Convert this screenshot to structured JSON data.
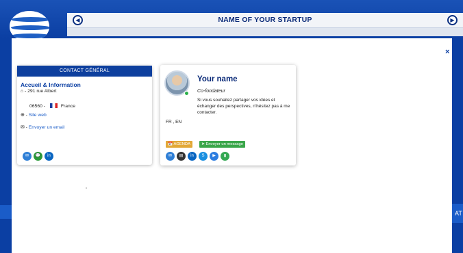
{
  "header": {
    "title": "NAME OF YOUR  STARTUP",
    "prev_arrow": "◀",
    "next_arrow": "▶"
  },
  "side_tab": {
    "label": "AT"
  },
  "modal": {
    "close_label": "×"
  },
  "contact": {
    "header": "CONTACT GÉNÉRAL",
    "section_title": "Accueil & Information",
    "address_icon": "⌂",
    "address": "- 291 rue Albert",
    "postal": "06560 -",
    "country": "France",
    "web_icon": "⊕",
    "web_prefix": "-",
    "website_label": "Site web",
    "email_icon": "✉",
    "email_prefix": "-",
    "email_label": "Envoyer un email",
    "socials": [
      {
        "name": "email",
        "glyph": "✉",
        "color": "#2f7fd6"
      },
      {
        "name": "chat",
        "glyph": "💬",
        "color": "#2c9a3a"
      },
      {
        "name": "linkedin",
        "glyph": "in",
        "color": "#0a66c2"
      }
    ]
  },
  "profile": {
    "name": "Your name",
    "role": "Co-fondateur",
    "bio": "Si vous souhaitez partager vos idées et échanger des perspectives, n'hésitez pas à me contacter.",
    "languages": "FR , EN",
    "agenda_label": "📅 AGENDA",
    "message_label": "➤ Envoyer un message",
    "icons": [
      {
        "name": "email",
        "glyph": "✉",
        "color": "#2f7fd6"
      },
      {
        "name": "card",
        "glyph": "▤",
        "color": "#333333"
      },
      {
        "name": "linkedin",
        "glyph": "in",
        "color": "#0a66c2"
      },
      {
        "name": "skype",
        "glyph": "S",
        "color": "#1a8fe0"
      },
      {
        "name": "video",
        "glyph": "▶",
        "color": "#2d7de0"
      },
      {
        "name": "meet",
        "glyph": "▮",
        "color": "#34a853"
      }
    ]
  }
}
